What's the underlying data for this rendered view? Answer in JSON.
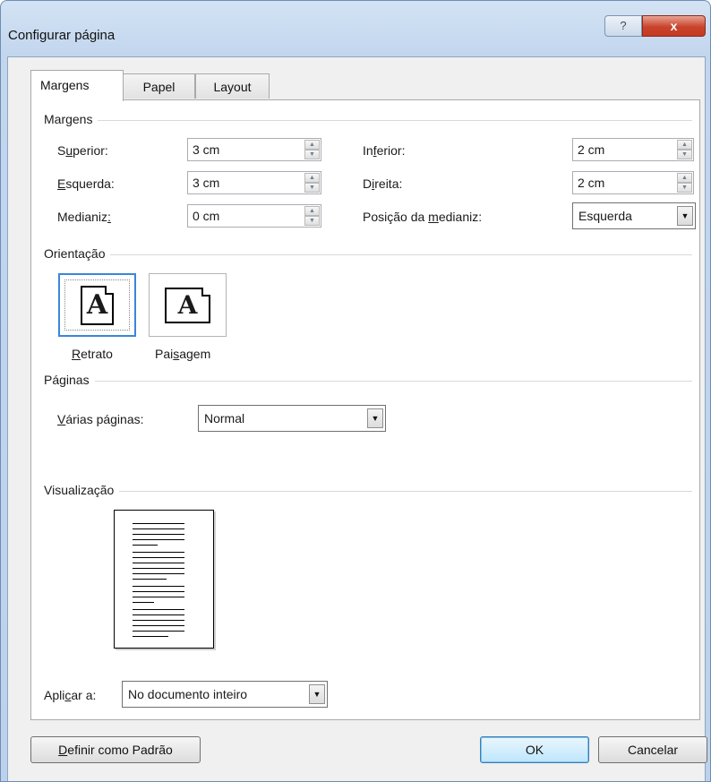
{
  "window": {
    "title": "Configurar página",
    "help_label": "?",
    "close_label": "x"
  },
  "tabs": [
    {
      "label": "Margens",
      "active": true
    },
    {
      "label": "Papel",
      "active": false
    },
    {
      "label": "Layout",
      "active": false
    }
  ],
  "margins": {
    "section_label": "Margens",
    "top_label_pre": "S",
    "top_label_u": "u",
    "top_label_post": "perior:",
    "top_value": "3 cm",
    "bottom_label_pre": "In",
    "bottom_label_u": "f",
    "bottom_label_post": "erior:",
    "bottom_value": "2 cm",
    "left_label_pre": "",
    "left_label_u": "E",
    "left_label_post": "squerda:",
    "left_value": "3 cm",
    "right_label_pre": "D",
    "right_label_u": "i",
    "right_label_post": "reita:",
    "right_value": "2 cm",
    "gutter_label_pre": "Medianiz",
    "gutter_label_u": ":",
    "gutter_label_post": "",
    "gutter_value": "0 cm",
    "gutter_pos_label_pre": "Posição da ",
    "gutter_pos_label_u": "m",
    "gutter_pos_label_post": "edianiz:",
    "gutter_pos_value": "Esquerda"
  },
  "orientation": {
    "section_label": "Orientação",
    "portrait_label_u": "R",
    "portrait_label_post": "etrato",
    "landscape_label_pre": "Pai",
    "landscape_label_u": "s",
    "landscape_label_post": "agem",
    "icon_glyph": "A",
    "selected": "portrait"
  },
  "pages": {
    "section_label": "Páginas",
    "multiple_label_u": "V",
    "multiple_label_post": "árias páginas:",
    "multiple_value": "Normal"
  },
  "preview": {
    "section_label": "Visualização"
  },
  "apply": {
    "label_pre": "Apli",
    "label_u": "c",
    "label_post": "ar a:",
    "value": "No documento inteiro"
  },
  "buttons": {
    "default_u": "D",
    "default_post": "efinir como Padrão",
    "ok": "OK",
    "cancel": "Cancelar"
  },
  "icons": {
    "spin_up": "▲",
    "spin_down": "▼",
    "dropdown": "▼"
  }
}
